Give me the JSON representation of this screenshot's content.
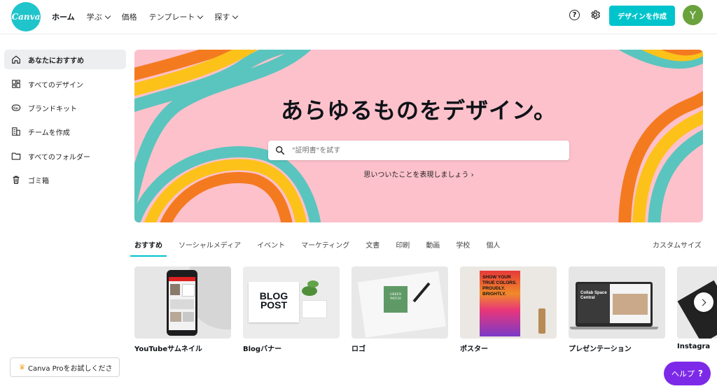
{
  "app": {
    "logo_text": "Canva"
  },
  "nav": {
    "items": [
      {
        "label": "ホーム",
        "dropdown": false
      },
      {
        "label": "学ぶ",
        "dropdown": true
      },
      {
        "label": "価格",
        "dropdown": false
      },
      {
        "label": "テンプレート",
        "dropdown": true
      },
      {
        "label": "探す",
        "dropdown": true
      }
    ],
    "help_glyph": "?",
    "create_label": "デザインを作成",
    "avatar_initial": "Y"
  },
  "sidebar": {
    "items": [
      {
        "label": "あなたにおすすめ",
        "icon": "home-icon"
      },
      {
        "label": "すべてのデザイン",
        "icon": "grid-icon"
      },
      {
        "label": "ブランドキット",
        "icon": "brand-kit-icon"
      },
      {
        "label": "チームを作成",
        "icon": "team-icon"
      },
      {
        "label": "すべてのフォルダー",
        "icon": "folder-icon"
      },
      {
        "label": "ゴミ箱",
        "icon": "trash-icon"
      }
    ],
    "pro_label": "Canva Proをお試しくださ"
  },
  "hero": {
    "title": "あらゆるものをデザイン。",
    "search_placeholder": "\"証明書\"を試す",
    "link": "思いついたことを表現しましょう ›"
  },
  "tabs": {
    "items": [
      "おすすめ",
      "ソーシャルメディア",
      "イベント",
      "マーケティング",
      "文書",
      "印刷",
      "動画",
      "学校",
      "個人"
    ],
    "custom_size": "カスタムサイズ"
  },
  "cards": {
    "items": [
      {
        "label": "YouTubeサムネイル"
      },
      {
        "label": "Blogバナー"
      },
      {
        "label": "ロゴ"
      },
      {
        "label": "ポスター"
      },
      {
        "label": "プレゼンテーション"
      },
      {
        "label": "Instagra"
      }
    ],
    "blog_text": "BLOG\nPOST",
    "logo_text": "GREEN\nPATCH",
    "poster_text": "SHOW YOUR TRUE COLORS. PROUDLY. BRIGHTLY.",
    "present_text": "Collab Space Central"
  },
  "help_button": {
    "label": "ヘルプ",
    "glyph": "?"
  },
  "colors": {
    "brand_teal": "#00c4cc",
    "hero_pink": "#fdc1cb",
    "help_purple": "#7d2ae8",
    "avatar_green": "#6aa23d"
  }
}
